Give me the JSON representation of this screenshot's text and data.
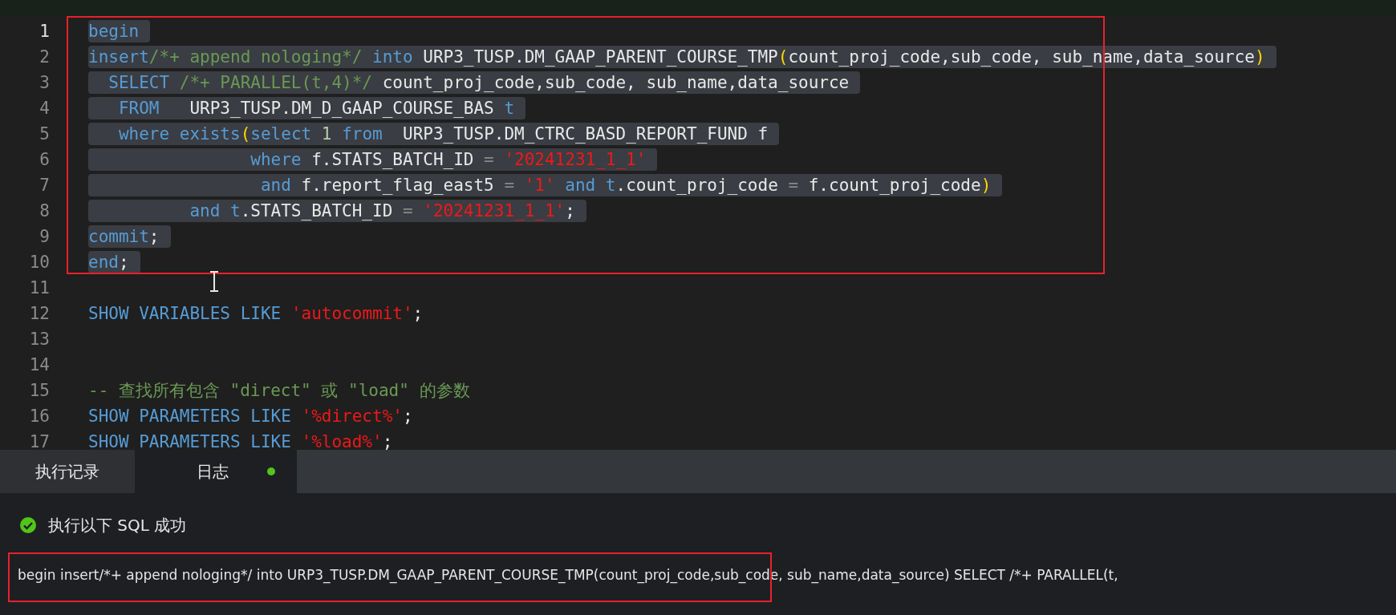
{
  "editor": {
    "lines": [
      {
        "number": "1",
        "current": true,
        "selected": true,
        "tokens": [
          {
            "kind": "keyword",
            "text": "begin"
          }
        ]
      },
      {
        "number": "2",
        "current": false,
        "selected": true,
        "tokens": [
          {
            "kind": "keyword",
            "text": "insert"
          },
          {
            "kind": "comment",
            "text": "/*+ append nologing*/ "
          },
          {
            "kind": "keyword",
            "text": "into"
          },
          {
            "kind": "ident",
            "text": " URP3_TUSP.DM_GAAP_PARENT_COURSE_TMP"
          },
          {
            "kind": "paren",
            "text": "("
          },
          {
            "kind": "ident",
            "text": "count_proj_code,sub_code, sub_name,data_source"
          },
          {
            "kind": "paren",
            "text": ")"
          }
        ]
      },
      {
        "number": "3",
        "current": false,
        "selected": true,
        "tokens": [
          {
            "kind": "keyword",
            "text": "  SELECT "
          },
          {
            "kind": "comment",
            "text": "/*+ PARALLEL(t,4)*/"
          },
          {
            "kind": "ident",
            "text": " count_proj_code,sub_code, sub_name,data_source"
          }
        ]
      },
      {
        "number": "4",
        "current": false,
        "selected": true,
        "tokens": [
          {
            "kind": "keyword",
            "text": "   FROM"
          },
          {
            "kind": "ident",
            "text": "   URP3_TUSP.DM_D_GAAP_COURSE_BAS "
          },
          {
            "kind": "keyword",
            "text": "t"
          }
        ]
      },
      {
        "number": "5",
        "current": false,
        "selected": true,
        "tokens": [
          {
            "kind": "keyword",
            "text": "   where exists"
          },
          {
            "kind": "paren",
            "text": "("
          },
          {
            "kind": "keyword",
            "text": "select "
          },
          {
            "kind": "number",
            "text": "1"
          },
          {
            "kind": "keyword",
            "text": " from"
          },
          {
            "kind": "ident",
            "text": "  URP3_TUSP.DM_CTRC_BASD_REPORT_FUND f"
          }
        ]
      },
      {
        "number": "6",
        "current": false,
        "selected": true,
        "tokens": [
          {
            "kind": "keyword",
            "text": "                where"
          },
          {
            "kind": "ident",
            "text": " f.STATS_BATCH_ID "
          },
          {
            "kind": "op",
            "text": "="
          },
          {
            "kind": "string",
            "text": " '20241231_1_1'"
          }
        ]
      },
      {
        "number": "7",
        "current": false,
        "selected": true,
        "tokens": [
          {
            "kind": "keyword",
            "text": "                 and"
          },
          {
            "kind": "ident",
            "text": " f.report_flag_east5 "
          },
          {
            "kind": "op",
            "text": "="
          },
          {
            "kind": "string",
            "text": " '1'"
          },
          {
            "kind": "keyword",
            "text": " and t"
          },
          {
            "kind": "ident",
            "text": ".count_proj_code "
          },
          {
            "kind": "op",
            "text": "="
          },
          {
            "kind": "ident",
            "text": " f.count_proj_code"
          },
          {
            "kind": "paren",
            "text": ")"
          }
        ]
      },
      {
        "number": "8",
        "current": false,
        "selected": true,
        "tokens": [
          {
            "kind": "keyword",
            "text": "          and t"
          },
          {
            "kind": "ident",
            "text": ".STATS_BATCH_ID "
          },
          {
            "kind": "op",
            "text": "="
          },
          {
            "kind": "string",
            "text": " '20241231_1_1'"
          },
          {
            "kind": "ident",
            "text": ";"
          }
        ]
      },
      {
        "number": "9",
        "current": false,
        "selected": true,
        "tokens": [
          {
            "kind": "keyword",
            "text": "commit"
          },
          {
            "kind": "ident",
            "text": ";"
          }
        ]
      },
      {
        "number": "10",
        "current": false,
        "selected": true,
        "tokens": [
          {
            "kind": "keyword",
            "text": "end"
          },
          {
            "kind": "ident",
            "text": ";"
          }
        ]
      },
      {
        "number": "11",
        "current": false
      },
      {
        "number": "12",
        "current": false,
        "selected": false,
        "tokens": [
          {
            "kind": "keyword",
            "text": "SHOW VARIABLES LIKE "
          },
          {
            "kind": "string",
            "text": "'autocommit'"
          },
          {
            "kind": "ident",
            "text": ";"
          }
        ]
      },
      {
        "number": "13",
        "current": false
      },
      {
        "number": "14",
        "current": false
      },
      {
        "number": "15",
        "current": false,
        "selected": false,
        "tokens": [
          {
            "kind": "comment",
            "text": "-- 查找所有包含 \"direct\" 或 \"load\" 的参数"
          }
        ]
      },
      {
        "number": "16",
        "current": false,
        "selected": false,
        "tokens": [
          {
            "kind": "keyword",
            "text": "SHOW PARAMETERS LIKE "
          },
          {
            "kind": "string",
            "text": "'%direct%'"
          },
          {
            "kind": "ident",
            "text": ";"
          }
        ]
      },
      {
        "number": "17",
        "current": false,
        "selected": false,
        "tokens": [
          {
            "kind": "keyword",
            "text": "SHOW PARAMETERS LIKE "
          },
          {
            "kind": "string",
            "text": "'%load%'"
          },
          {
            "kind": "ident",
            "text": ";"
          }
        ]
      }
    ]
  },
  "panel": {
    "tabs": [
      {
        "label": "执行记录",
        "selected": false,
        "indicator": false
      },
      {
        "label": "日志",
        "selected": true,
        "indicator": true
      }
    ],
    "log": {
      "success": true,
      "message": "执行以下 SQL 成功",
      "sql": "begin insert/*+ append nologing*/ into URP3_TUSP.DM_GAAP_PARENT_COURSE_TMP(count_proj_code,sub_code, sub_name,data_source) SELECT /*+ PARALLEL(t,"
    }
  }
}
